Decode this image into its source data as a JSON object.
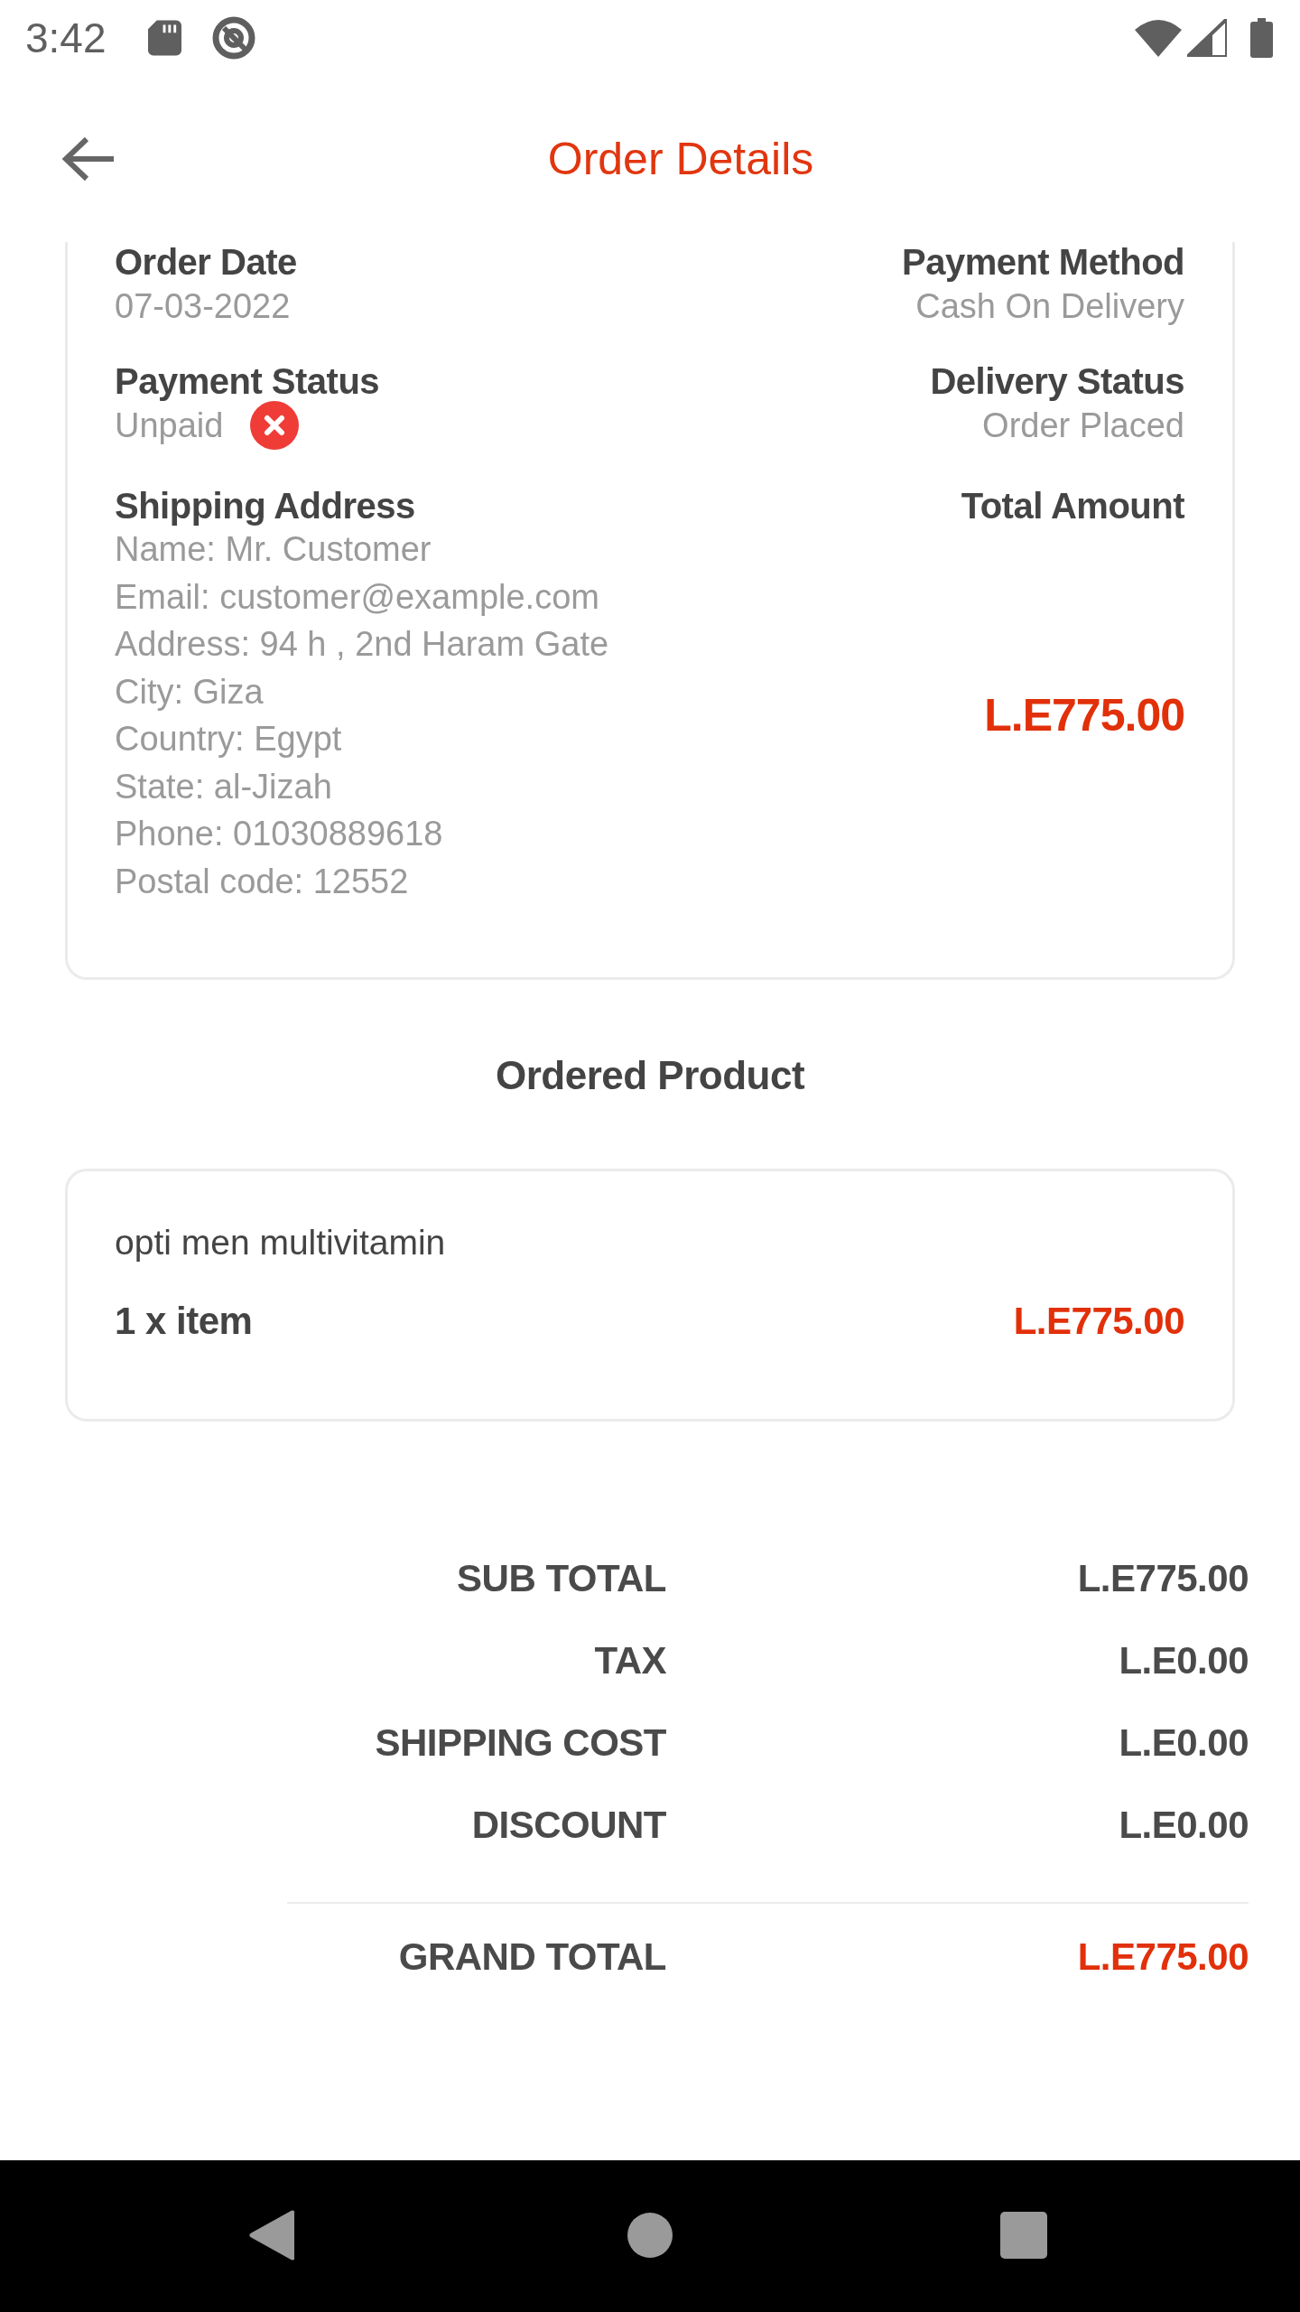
{
  "status_bar": {
    "time": "3:42"
  },
  "toolbar": {
    "title": "Order Details"
  },
  "order_info": {
    "rows": [
      {
        "left": {
          "label": "Order Date",
          "value": "07-03-2022"
        },
        "right": {
          "label": "Payment Method",
          "value": "Cash On Delivery"
        }
      },
      {
        "left": {
          "label": "Payment Status",
          "value": "Unpaid",
          "paid": false
        },
        "right": {
          "label": "Delivery Status",
          "value": "Order Placed"
        }
      }
    ],
    "shipping_address": {
      "label": "Shipping Address",
      "lines": [
        "Name: Mr. Customer",
        "Email: customer@example.com",
        "Address: 94 h , 2nd Haram Gate",
        "City: Giza",
        "Country: Egypt",
        "State: al-Jizah",
        "Phone: 01030889618",
        "Postal code: 12552"
      ]
    },
    "total_amount": {
      "label": "Total Amount",
      "value": "L.E775.00"
    }
  },
  "ordered_product": {
    "heading": "Ordered Product",
    "items": [
      {
        "name": "opti men multivitamin",
        "quantity": "1 x item",
        "price": "L.E775.00"
      }
    ]
  },
  "totals": {
    "rows": [
      {
        "label": "SUB TOTAL",
        "value": "L.E775.00"
      },
      {
        "label": "TAX",
        "value": "L.E0.00"
      },
      {
        "label": "SHIPPING COST",
        "value": "L.E0.00"
      },
      {
        "label": "DISCOUNT",
        "value": "L.E0.00"
      }
    ],
    "grand_total": {
      "label": "GRAND TOTAL",
      "value": "L.E775.00"
    }
  }
}
